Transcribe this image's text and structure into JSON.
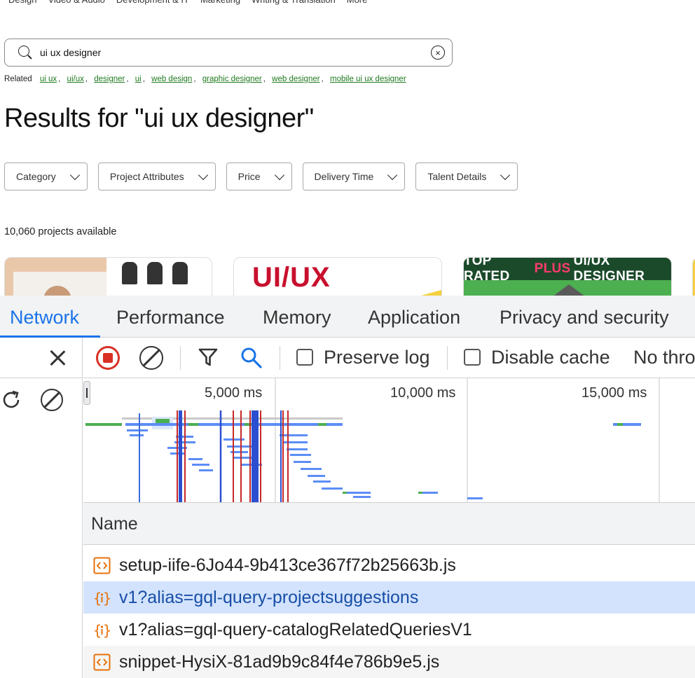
{
  "topnav": [
    "Design",
    "Video & Audio",
    "Development & IT",
    "Marketing",
    "Writing & Translation",
    "More"
  ],
  "search": {
    "value": "ui ux designer"
  },
  "related": {
    "label": "Related",
    "items": [
      "ui ux",
      "ui/ux",
      "designer",
      "ui",
      "web design",
      "graphic designer",
      "web designer",
      "mobile ui ux designer"
    ]
  },
  "results_title": "Results for \"ui ux designer\"",
  "filters": [
    "Category",
    "Project Attributes",
    "Price",
    "Delivery Time",
    "Talent Details"
  ],
  "count": "10,060 projects available",
  "cards": {
    "card2_text": "UI/UX",
    "card3_prefix": "TOP RATED",
    "card3_plus": "PLUS",
    "card3_suffix": "UI/UX DESIGNER"
  },
  "devtools": {
    "tabs": [
      "Network",
      "Performance",
      "Memory",
      "Application",
      "Privacy and security"
    ],
    "active_tab": "Network",
    "toolbar": {
      "preserve_log": "Preserve log",
      "disable_cache": "Disable cache",
      "throttle": "No thro"
    },
    "timeline_ticks": [
      "5,000 ms",
      "10,000 ms",
      "15,000 ms"
    ],
    "name_header": "Name",
    "requests": [
      {
        "name": "setup-iife-6Jo44-9b413ce367f72b25663b.js",
        "type": "script"
      },
      {
        "name": "v1?alias=gql-query-projectsuggestions",
        "type": "fetch"
      },
      {
        "name": "v1?alias=gql-query-catalogRelatedQueriesV1",
        "type": "fetch"
      },
      {
        "name": "snippet-HysiX-81ad9b9c84f4e786b9e5.js",
        "type": "script"
      }
    ],
    "selected_request": 1
  },
  "colors": {
    "accent": "#1a73e8",
    "record": "#d93025",
    "link": "#1f7a1f",
    "selected_row": "#d3e3fd",
    "script_icon": "#e8710a",
    "waterfall_blue": "#5c8df6",
    "waterfall_green": "#4caf50"
  }
}
